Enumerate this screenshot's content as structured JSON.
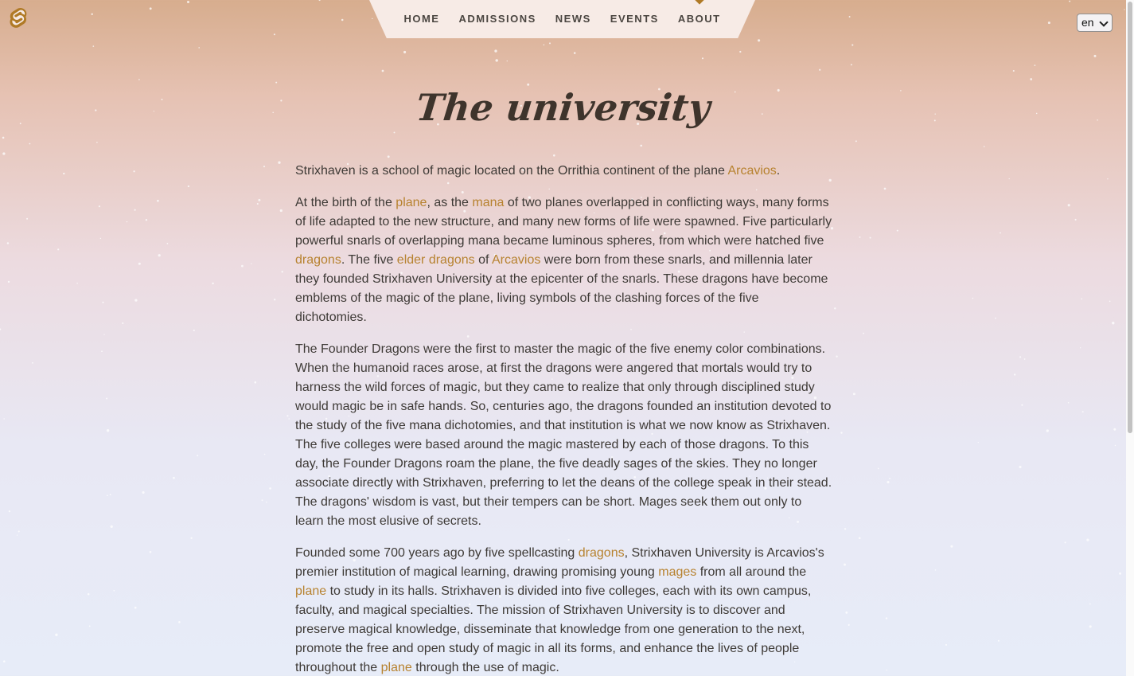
{
  "brand": {
    "logo_icon": "svelte-logo-icon",
    "accent": "#b07a26"
  },
  "nav": {
    "items": [
      {
        "label": "HOME",
        "active": false
      },
      {
        "label": "ADMISSIONS",
        "active": false
      },
      {
        "label": "NEWS",
        "active": false
      },
      {
        "label": "EVENTS",
        "active": false
      },
      {
        "label": "ABOUT",
        "active": true
      }
    ]
  },
  "language": {
    "selected": "en"
  },
  "page": {
    "title": "The university",
    "link_color": "#b7822f",
    "p1": {
      "t0": "Strixhaven is a school of magic located on the Orrithia continent of the plane ",
      "l0": "Arcavios",
      "t1": "."
    },
    "p2": {
      "t0": "At the birth of the ",
      "l0": "plane",
      "t1": ", as the ",
      "l1": "mana",
      "t2": " of two planes overlapped in conflicting ways, many forms of life adapted to the new structure, and many new forms of life were spawned. Five particularly powerful snarls of overlapping mana became luminous spheres, from which were hatched five ",
      "l2": "dragons",
      "t3": ". The five ",
      "l3": "elder dragons",
      "t4": " of ",
      "l4": "Arcavios",
      "t5": " were born from these snarls, and millennia later they founded Strixhaven University at the epicenter of the snarls. These dragons have become emblems of the magic of the plane, living symbols of the clashing forces of the five dichotomies."
    },
    "p3": {
      "t0": "The Founder Dragons were the first to master the magic of the five enemy color combinations. When the humanoid races arose, at first the dragons were angered that mortals would try to harness the wild forces of magic, but they came to realize that only through disciplined study would magic be in safe hands. So, centuries ago, the dragons founded an institution devoted to the study of the five mana dichotomies, and that institution is what we now know as Strixhaven. The five colleges were based around the magic mastered by each of those dragons. To this day, the Founder Dragons roam the plane, the five deadly sages of the skies. They no longer associate directly with Strixhaven, preferring to let the deans of the college speak in their stead. The dragons' wisdom is vast, but their tempers can be short. Mages seek them out only to learn the most elusive of secrets."
    },
    "p4": {
      "t0": "Founded some 700 years ago by five spellcasting ",
      "l0": "dragons",
      "t1": ", Strixhaven University is Arcavios's premier institution of magical learning, drawing promising young ",
      "l1": "mages",
      "t2": " from all around the ",
      "l2": "plane",
      "t3": " to study in its halls. Strixhaven is divided into five colleges, each with its own campus, faculty, and magical specialties. The mission of Strixhaven University is to discover and preserve magical knowledge, disseminate that knowledge from one generation to the next, promote the free and open study of magic in all its forms, and enhance the lives of people throughout the ",
      "l3": "plane",
      "t4": " through the use of magic."
    }
  }
}
